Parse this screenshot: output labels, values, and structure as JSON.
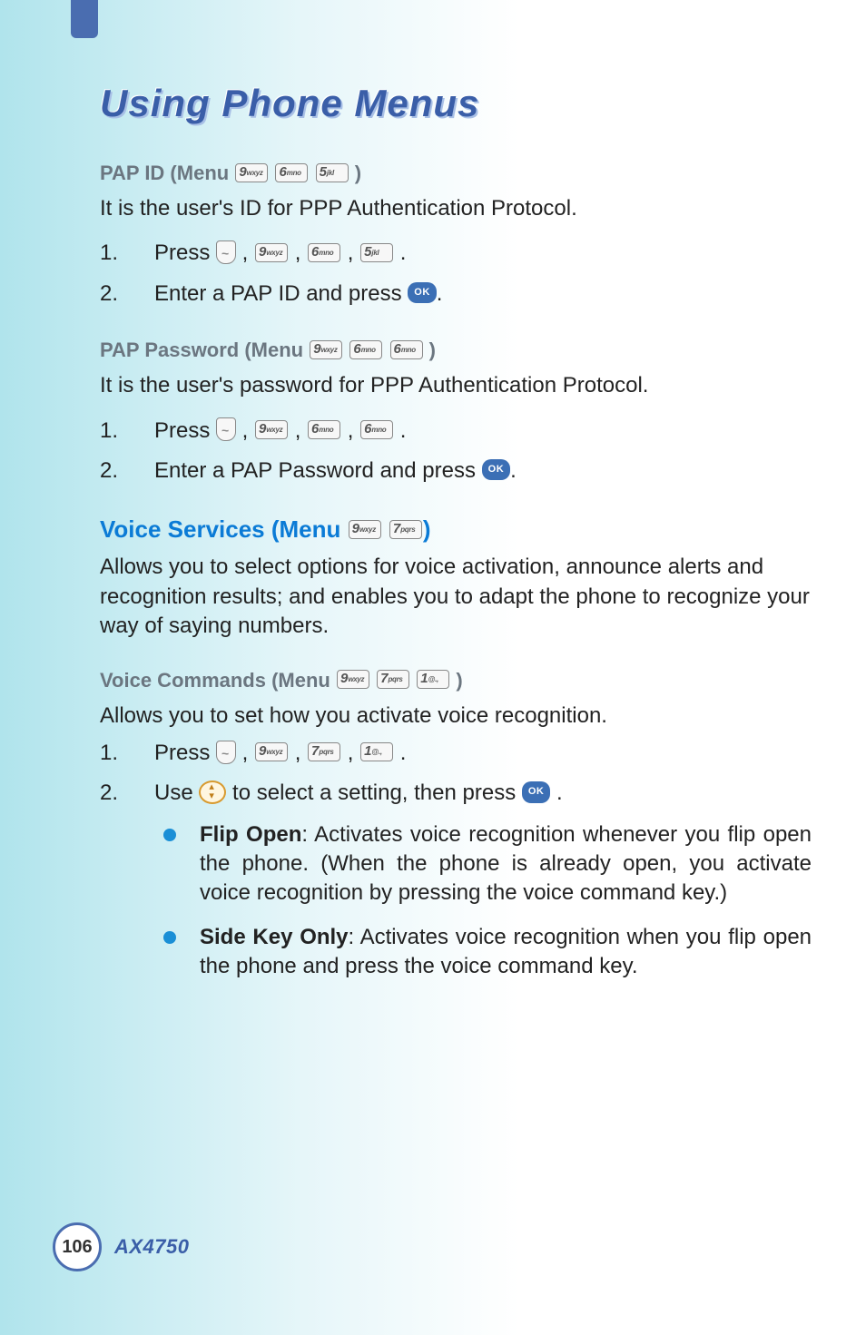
{
  "page": {
    "title": "Using Phone Menus",
    "number": "106",
    "model": "AX4750"
  },
  "keys": {
    "k9": {
      "big": "9",
      "sub": "wxyz"
    },
    "k6": {
      "big": "6",
      "sub": "mno"
    },
    "k5": {
      "big": "5",
      "sub": "jkl"
    },
    "k7": {
      "big": "7",
      "sub": "pqrs"
    },
    "k1": {
      "big": "1",
      "sub": "@.,"
    },
    "ok": "OK"
  },
  "pap_id": {
    "heading_pre": "PAP ID (Menu ",
    "heading_post": " )",
    "desc": "It is the user's ID for PPP Authentication Protocol.",
    "steps": {
      "s1_num": "1.",
      "s1_pre": "Press ",
      "s2_num": "2.",
      "s2_pre": "Enter a PAP ID and press "
    }
  },
  "pap_pw": {
    "heading_pre": "PAP Password (Menu ",
    "heading_post": " )",
    "desc": "It is the user's password for PPP Authentication Protocol.",
    "steps": {
      "s1_num": "1.",
      "s1_pre": "Press ",
      "s2_num": "2.",
      "s2_pre": "Enter a PAP Password and press "
    }
  },
  "voice_services": {
    "heading_pre": "Voice Services (Menu ",
    "heading_post": ")",
    "desc": "Allows you to select options for voice activation, announce alerts and recognition results; and enables you to adapt the phone to recognize your way of saying numbers."
  },
  "voice_commands": {
    "heading_pre": "Voice Commands (Menu ",
    "heading_post": " )",
    "desc": "Allows you to set how you activate voice recognition.",
    "steps": {
      "s1_num": "1.",
      "s1_pre": "Press ",
      "s2_num": "2.",
      "s2_pre": "Use ",
      "s2_mid": " to select a setting, then press "
    },
    "bullets": {
      "flip_label": "Flip Open",
      "flip_text": ": Activates voice recognition whenever you flip open the phone. (When the phone is already open, you activate voice recognition by pressing the voice command key.)",
      "side_label": "Side Key Only",
      "side_text": ": Activates voice recognition when you flip open the phone and press the voice command key."
    }
  }
}
